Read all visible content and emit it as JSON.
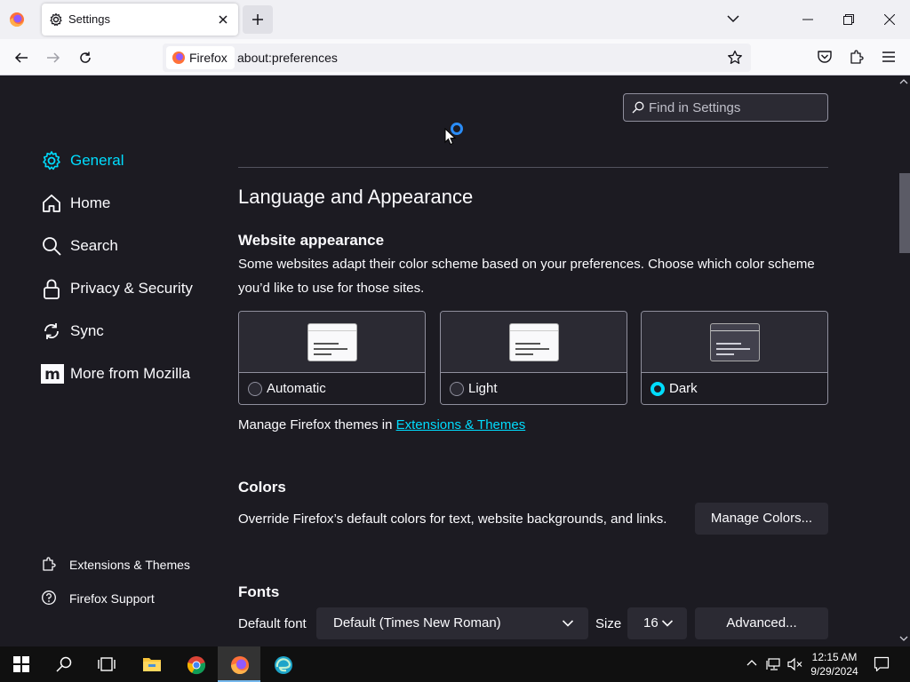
{
  "browser": {
    "tab_title": "Settings",
    "identity_label": "Firefox",
    "url": "about:preferences"
  },
  "search": {
    "placeholder": "Find in Settings"
  },
  "sidebar": {
    "items": [
      {
        "label": "General",
        "icon": "gear-icon",
        "active": true
      },
      {
        "label": "Home",
        "icon": "home-icon"
      },
      {
        "label": "Search",
        "icon": "search-icon"
      },
      {
        "label": "Privacy & Security",
        "icon": "lock-icon"
      },
      {
        "label": "Sync",
        "icon": "sync-icon"
      },
      {
        "label": "More from Mozilla",
        "icon": "mozilla-icon"
      }
    ],
    "footer": [
      {
        "label": "Extensions & Themes",
        "icon": "puzzle-icon"
      },
      {
        "label": "Firefox Support",
        "icon": "help-icon"
      }
    ]
  },
  "main": {
    "section_title": "Language and Appearance",
    "appearance": {
      "heading": "Website appearance",
      "description_line1": "Some websites adapt their color scheme based on your preferences. Choose which color scheme",
      "description_line2": "you’d like to use for those sites.",
      "options": [
        {
          "label": "Automatic",
          "checked": false
        },
        {
          "label": "Light",
          "checked": false
        },
        {
          "label": "Dark",
          "checked": true
        }
      ],
      "themes_prefix": "Manage Firefox themes in ",
      "themes_link": "Extensions & Themes"
    },
    "colors": {
      "heading": "Colors",
      "description": "Override Firefox’s default colors for text, website backgrounds, and links.",
      "button": "Manage Colors..."
    },
    "fonts": {
      "heading": "Fonts",
      "default_font_label": "Default font",
      "default_font_value": "Default (Times New Roman)",
      "size_label": "Size",
      "size_value": "16",
      "advanced_button": "Advanced..."
    }
  },
  "taskbar": {
    "time": "12:15 AM",
    "date": "9/29/2024"
  },
  "colors": {
    "accent": "#00ddff",
    "background": "#1c1b22",
    "surface": "#2b2a33"
  }
}
